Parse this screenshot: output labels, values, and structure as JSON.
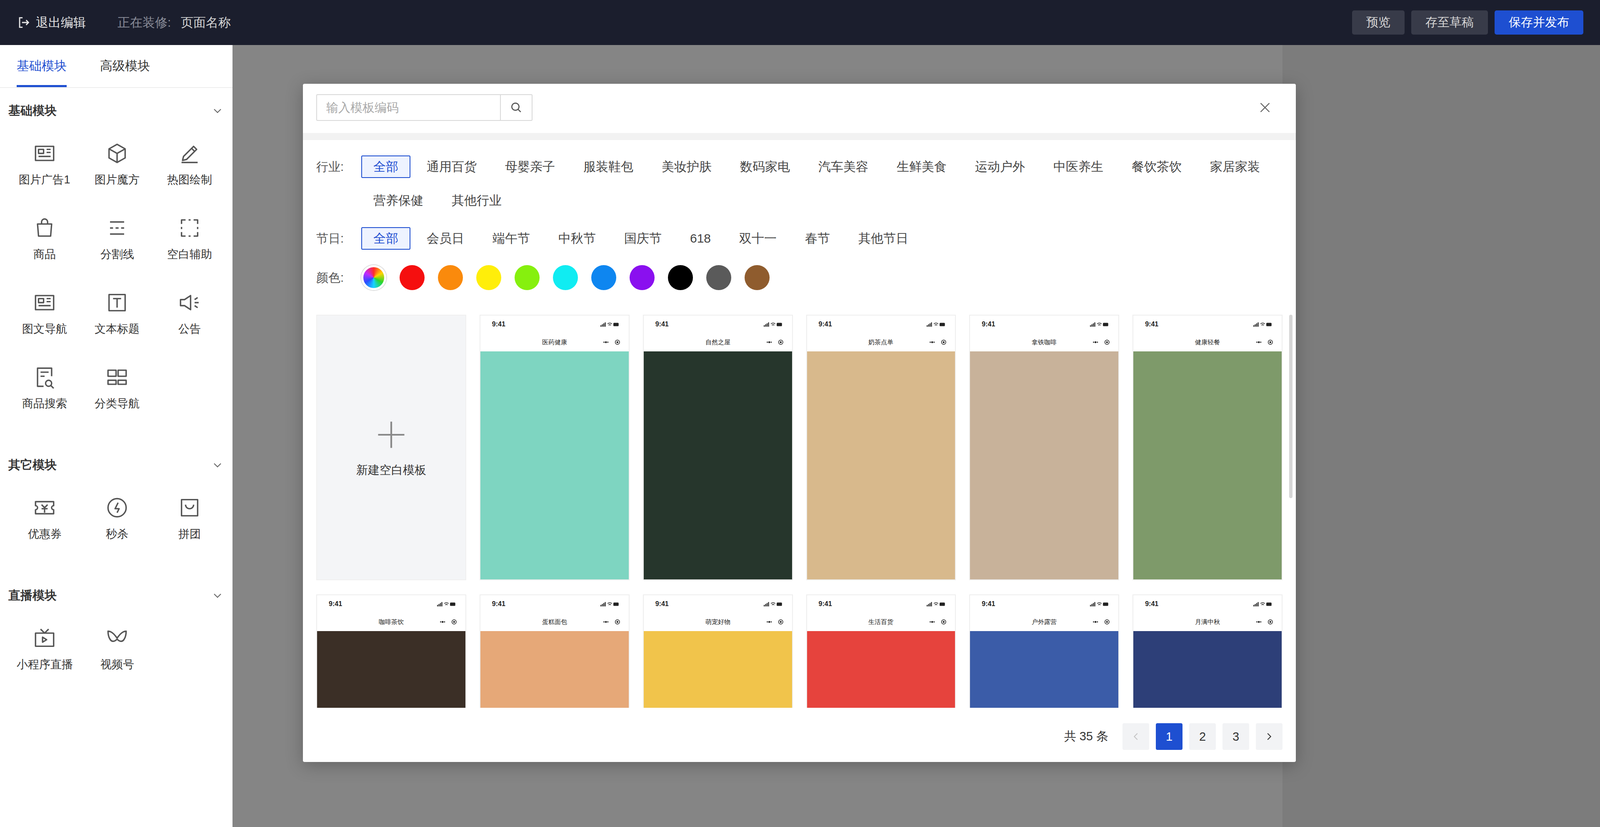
{
  "topbar": {
    "exit": "退出编辑",
    "editing_label": "正在装修:",
    "page_name": "页面名称",
    "buttons": [
      {
        "label": "预览",
        "primary": false
      },
      {
        "label": "存至草稿",
        "primary": false
      },
      {
        "label": "保存并发布",
        "primary": true
      }
    ]
  },
  "sidebar": {
    "tabs": [
      {
        "label": "基础模块",
        "selected": true
      },
      {
        "label": "高级模块",
        "selected": false
      }
    ],
    "sections": [
      {
        "title": "基础模块",
        "expanded": true,
        "items": [
          "图片广告1",
          "图片魔方",
          "热图绘制",
          "商品",
          "分割线",
          "空白辅助",
          "图文导航",
          "文本标题",
          "公告",
          "商品搜索",
          "分类导航"
        ]
      },
      {
        "title": "其它模块",
        "expanded": true,
        "items": [
          "优惠券",
          "秒杀",
          "拼团"
        ]
      },
      {
        "title": "直播模块",
        "expanded": true,
        "items": [
          "小程序直播",
          "视频号"
        ]
      }
    ]
  },
  "template_dialog": {
    "search": {
      "placeholder": "输入模板编码"
    },
    "filters": [
      {
        "label": "行业:",
        "options": [
          {
            "label": "全部",
            "selected": true
          },
          {
            "label": "通用百货",
            "selected": false
          },
          {
            "label": "母婴亲子",
            "selected": false
          },
          {
            "label": "服装鞋包",
            "selected": false
          },
          {
            "label": "美妆护肤",
            "selected": false
          },
          {
            "label": "数码家电",
            "selected": false
          },
          {
            "label": "汽车美容",
            "selected": false
          },
          {
            "label": "生鲜美食",
            "selected": false
          },
          {
            "label": "运动户外",
            "selected": false
          },
          {
            "label": "中医养生",
            "selected": false
          },
          {
            "label": "餐饮茶饮",
            "selected": false
          },
          {
            "label": "家居家装",
            "selected": false
          },
          {
            "label": "营养保健",
            "selected": false
          },
          {
            "label": "其他行业",
            "selected": false
          }
        ]
      },
      {
        "label": "节日:",
        "options": [
          {
            "label": "全部",
            "selected": true
          },
          {
            "label": "会员日",
            "selected": false
          },
          {
            "label": "端午节",
            "selected": false
          },
          {
            "label": "中秋节",
            "selected": false
          },
          {
            "label": "国庆节",
            "selected": false
          },
          {
            "label": "618",
            "selected": false
          },
          {
            "label": "双十一",
            "selected": false
          },
          {
            "label": "春节",
            "selected": false
          },
          {
            "label": "其他节日",
            "selected": false
          }
        ]
      }
    ],
    "colors": {
      "label": "颜色:",
      "swatches": [
        {
          "kind": "all",
          "selected": false
        },
        {
          "kind": "solid",
          "color": "#f50f0f",
          "selected": false
        },
        {
          "kind": "solid",
          "color": "#fa8a0c",
          "selected": false
        },
        {
          "kind": "solid",
          "color": "#ffee0a",
          "selected": false
        },
        {
          "kind": "solid",
          "color": "#86f00e",
          "selected": false
        },
        {
          "kind": "solid",
          "color": "#10ecf2",
          "selected": false
        },
        {
          "kind": "solid",
          "color": "#0e86f0",
          "selected": false
        },
        {
          "kind": "solid",
          "color": "#8a10ef",
          "selected": false
        },
        {
          "kind": "solid",
          "color": "#000000",
          "selected": false
        },
        {
          "kind": "solid",
          "color": "#5a5a5a",
          "selected": false
        },
        {
          "kind": "solid",
          "color": "#8f5c2e",
          "selected": false
        }
      ]
    },
    "new_template": {
      "label": "新建空白模板"
    },
    "templates": [
      {
        "time": "9:41",
        "title": "医药健康",
        "color": "#7ed5c1"
      },
      {
        "time": "9:41",
        "title": "自然之屋",
        "color": "#26362c"
      },
      {
        "time": "9:41",
        "title": "奶茶点单",
        "color": "#d8b98c"
      },
      {
        "time": "9:41",
        "title": "拿铁咖啡",
        "color": "#c8b29a"
      },
      {
        "time": "9:41",
        "title": "健康轻餐",
        "color": "#7e9a6a"
      },
      {
        "time": "9:41",
        "title": "咖啡茶饮",
        "color": "#3b2f26"
      },
      {
        "time": "9:41",
        "title": "蛋糕面包",
        "color": "#e6a878"
      },
      {
        "time": "9:41",
        "title": "萌宠好物",
        "color": "#f1c44b"
      },
      {
        "time": "9:41",
        "title": "生活百货",
        "color": "#e6433d"
      },
      {
        "time": "9:41",
        "title": "户外露营",
        "color": "#3b5ca8"
      },
      {
        "time": "9:41",
        "title": "月满中秋",
        "color": "#2d3f78"
      }
    ],
    "pagination": {
      "total": "共 35 条",
      "prev_disabled": true,
      "next_disabled": false,
      "pages": [
        {
          "label": "1",
          "selected": true
        },
        {
          "label": "2",
          "selected": false
        },
        {
          "label": "3",
          "selected": false
        }
      ]
    }
  }
}
